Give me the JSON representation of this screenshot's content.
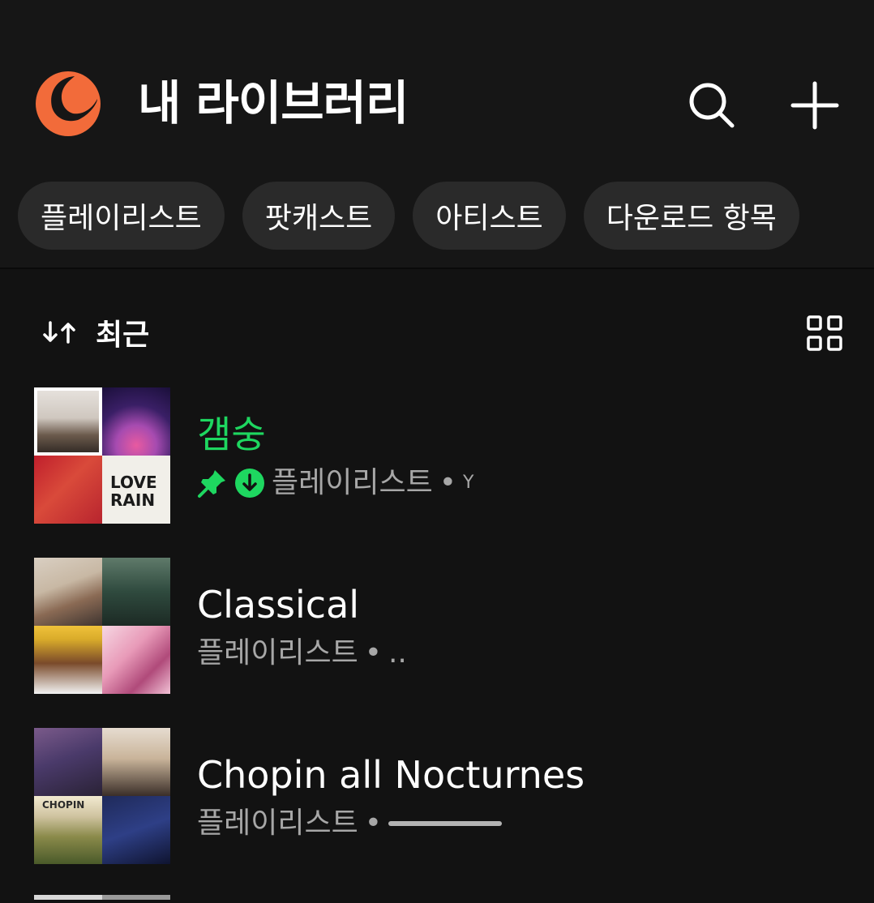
{
  "header": {
    "title": "내 라이브러리",
    "accent_color": "#f26b3a",
    "search_icon": "search-icon",
    "add_icon": "plus-icon"
  },
  "filters": [
    {
      "label": "플레이리스트"
    },
    {
      "label": "팟캐스트"
    },
    {
      "label": "아티스트"
    },
    {
      "label": "다운로드 항목"
    }
  ],
  "sort": {
    "icon": "sort-arrows-icon",
    "label": "최근",
    "view_icon": "grid-view-icon"
  },
  "library": [
    {
      "title": "갬숭",
      "title_color": "#1ed760",
      "pinned": true,
      "downloaded": true,
      "type": "플레이리스트",
      "owner_partial": "Y"
    },
    {
      "title": "Classical",
      "type": "플레이리스트",
      "owner_partial": "..",
      "pinned": false,
      "downloaded": false
    },
    {
      "title": "Chopin all Nocturnes",
      "type": "플레이리스트",
      "owner_partial": "",
      "pinned": false,
      "downloaded": false
    }
  ],
  "colors": {
    "background": "#121212",
    "chip_bg": "#2a2a2a",
    "spotify_green": "#1ed760",
    "secondary_text": "#a7a7a7"
  }
}
